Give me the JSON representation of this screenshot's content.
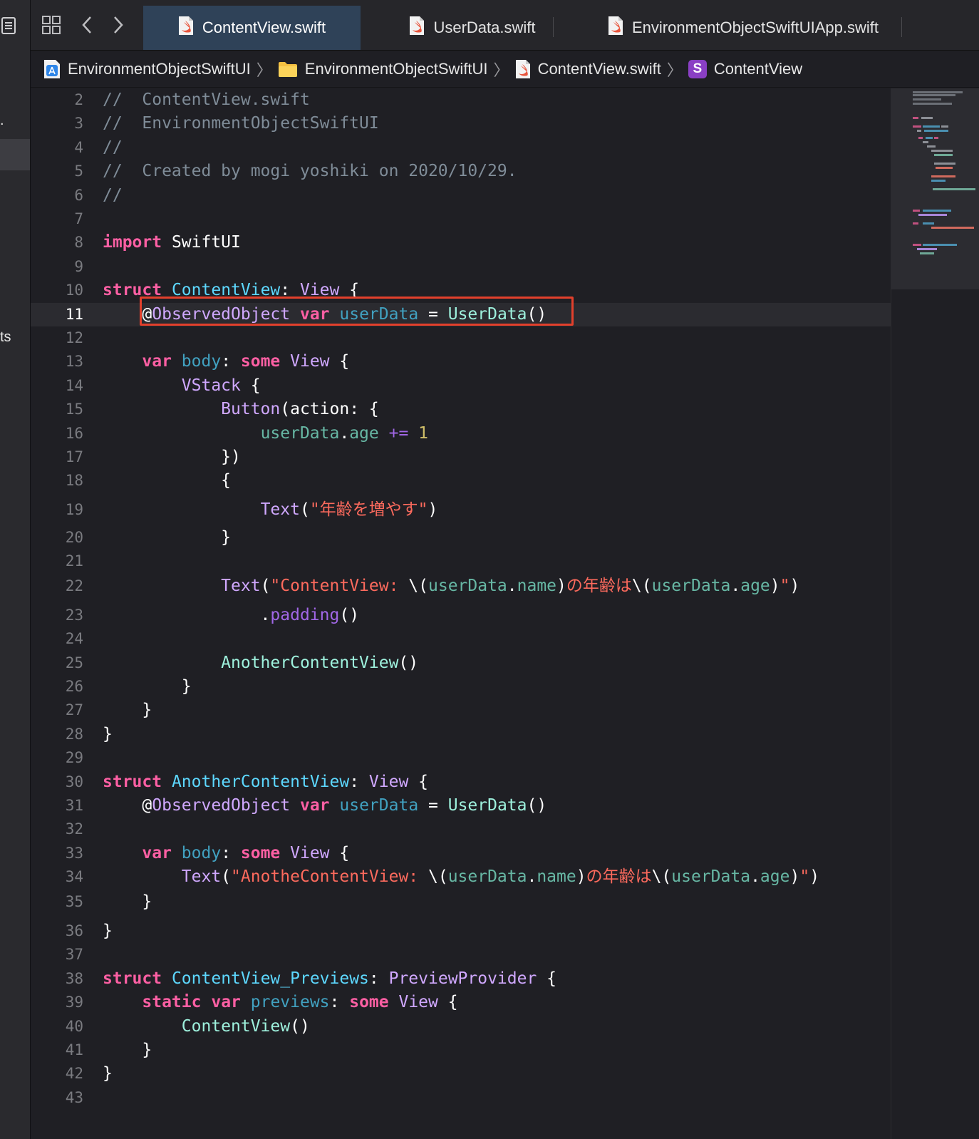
{
  "left_panel": {
    "fragments": [
      ".",
      "ts"
    ]
  },
  "toolbar": {
    "grid_icon": "grid-icon",
    "back_icon": "chevron-left-icon",
    "forward_icon": "chevron-right-icon"
  },
  "tabs": [
    {
      "label": "ContentView.swift",
      "active": true
    },
    {
      "label": "UserData.swift",
      "active": false
    },
    {
      "label": "EnvironmentObjectSwiftUIApp.swift",
      "active": false
    }
  ],
  "breadcrumb": [
    {
      "label": "EnvironmentObjectSwiftUI",
      "icon": "app-project-icon"
    },
    {
      "label": "EnvironmentObjectSwiftUI",
      "icon": "folder-icon"
    },
    {
      "label": "ContentView.swift",
      "icon": "swift-file-icon"
    },
    {
      "label": "ContentView",
      "icon": "struct-icon",
      "badge": "S"
    }
  ],
  "editor": {
    "current_line": 11,
    "highlighted_line": 11,
    "lines": [
      {
        "n": "2",
        "tokens": [
          [
            "cmt",
            "//  ContentView.swift"
          ]
        ]
      },
      {
        "n": "3",
        "tokens": [
          [
            "cmt",
            "//  EnvironmentObjectSwiftUI"
          ]
        ]
      },
      {
        "n": "4",
        "tokens": [
          [
            "cmt",
            "//"
          ]
        ]
      },
      {
        "n": "5",
        "tokens": [
          [
            "cmt",
            "//  Created by mogi yoshiki on 2020/10/29."
          ]
        ]
      },
      {
        "n": "6",
        "tokens": [
          [
            "cmt",
            "//"
          ]
        ]
      },
      {
        "n": "7",
        "tokens": []
      },
      {
        "n": "8",
        "tokens": [
          [
            "kw",
            "import"
          ],
          [
            "pl",
            " SwiftUI"
          ]
        ]
      },
      {
        "n": "9",
        "tokens": []
      },
      {
        "n": "10",
        "tokens": [
          [
            "kw",
            "struct"
          ],
          [
            "pl",
            " "
          ],
          [
            "td",
            "ContentView"
          ],
          [
            "pl",
            ": "
          ],
          [
            "tr",
            "View"
          ],
          [
            "pl",
            " {"
          ]
        ]
      },
      {
        "n": "11",
        "tokens": [
          [
            "pl",
            "    @"
          ],
          [
            "tr",
            "ObservedObject"
          ],
          [
            "pl",
            " "
          ],
          [
            "kw",
            "var"
          ],
          [
            "pl",
            " "
          ],
          [
            "pr",
            "userData"
          ],
          [
            "pl",
            " = "
          ],
          [
            "ot",
            "UserData"
          ],
          [
            "pl",
            "()"
          ]
        ]
      },
      {
        "n": "12",
        "tokens": []
      },
      {
        "n": "13",
        "tokens": [
          [
            "pl",
            "    "
          ],
          [
            "kw",
            "var"
          ],
          [
            "pl",
            " "
          ],
          [
            "pr",
            "body"
          ],
          [
            "pl",
            ": "
          ],
          [
            "kw",
            "some"
          ],
          [
            "pl",
            " "
          ],
          [
            "tr",
            "View"
          ],
          [
            "pl",
            " {"
          ]
        ]
      },
      {
        "n": "14",
        "tokens": [
          [
            "pl",
            "        "
          ],
          [
            "tr",
            "VStack"
          ],
          [
            "pl",
            " {"
          ]
        ]
      },
      {
        "n": "15",
        "tokens": [
          [
            "pl",
            "            "
          ],
          [
            "tr",
            "Button"
          ],
          [
            "pl",
            "(action: {"
          ]
        ]
      },
      {
        "n": "16",
        "tokens": [
          [
            "pl",
            "                "
          ],
          [
            "ov",
            "userData"
          ],
          [
            "pl",
            "."
          ],
          [
            "ov",
            "age"
          ],
          [
            "pl",
            " "
          ],
          [
            "cl",
            "+="
          ],
          [
            "pl",
            " "
          ],
          [
            "num",
            "1"
          ]
        ]
      },
      {
        "n": "17",
        "tokens": [
          [
            "pl",
            "            })"
          ]
        ]
      },
      {
        "n": "18",
        "tokens": [
          [
            "pl",
            "            {"
          ]
        ]
      },
      {
        "n": "19",
        "tokens": [
          [
            "pl",
            "                "
          ],
          [
            "tr",
            "Text"
          ],
          [
            "pl",
            "("
          ],
          [
            "str",
            "\"年齢を増やす\""
          ],
          [
            "pl",
            ")"
          ]
        ]
      },
      {
        "n": "20",
        "tokens": [
          [
            "pl",
            "            }"
          ]
        ]
      },
      {
        "n": "21",
        "tokens": []
      },
      {
        "n": "22",
        "tokens": [
          [
            "pl",
            "            "
          ],
          [
            "tr",
            "Text"
          ],
          [
            "pl",
            "("
          ],
          [
            "str",
            "\"ContentView: "
          ],
          [
            "pl",
            "\\("
          ],
          [
            "ov",
            "userData"
          ],
          [
            "pl",
            "."
          ],
          [
            "ov",
            "name"
          ],
          [
            "pl",
            ")"
          ],
          [
            "str",
            "の年齢は"
          ],
          [
            "pl",
            "\\("
          ],
          [
            "ov",
            "userData"
          ],
          [
            "pl",
            "."
          ],
          [
            "ov",
            "age"
          ],
          [
            "pl",
            ")"
          ],
          [
            "str",
            "\""
          ],
          [
            "pl",
            ")"
          ]
        ]
      },
      {
        "n": "23",
        "tokens": [
          [
            "pl",
            "                ."
          ],
          [
            "cl",
            "padding"
          ],
          [
            "pl",
            "()"
          ]
        ]
      },
      {
        "n": "24",
        "tokens": []
      },
      {
        "n": "25",
        "tokens": [
          [
            "pl",
            "            "
          ],
          [
            "ot",
            "AnotherContentView"
          ],
          [
            "pl",
            "()"
          ]
        ]
      },
      {
        "n": "26",
        "tokens": [
          [
            "pl",
            "        }"
          ]
        ]
      },
      {
        "n": "27",
        "tokens": [
          [
            "pl",
            "    }"
          ]
        ]
      },
      {
        "n": "28",
        "tokens": [
          [
            "pl",
            "}"
          ]
        ]
      },
      {
        "n": "29",
        "tokens": []
      },
      {
        "n": "30",
        "tokens": [
          [
            "kw",
            "struct"
          ],
          [
            "pl",
            " "
          ],
          [
            "td",
            "AnotherContentView"
          ],
          [
            "pl",
            ": "
          ],
          [
            "tr",
            "View"
          ],
          [
            "pl",
            " {"
          ]
        ]
      },
      {
        "n": "31",
        "tokens": [
          [
            "pl",
            "    @"
          ],
          [
            "tr",
            "ObservedObject"
          ],
          [
            "pl",
            " "
          ],
          [
            "kw",
            "var"
          ],
          [
            "pl",
            " "
          ],
          [
            "pr",
            "userData"
          ],
          [
            "pl",
            " = "
          ],
          [
            "ot",
            "UserData"
          ],
          [
            "pl",
            "()"
          ]
        ]
      },
      {
        "n": "32",
        "tokens": []
      },
      {
        "n": "33",
        "tokens": [
          [
            "pl",
            "    "
          ],
          [
            "kw",
            "var"
          ],
          [
            "pl",
            " "
          ],
          [
            "pr",
            "body"
          ],
          [
            "pl",
            ": "
          ],
          [
            "kw",
            "some"
          ],
          [
            "pl",
            " "
          ],
          [
            "tr",
            "View"
          ],
          [
            "pl",
            " {"
          ]
        ]
      },
      {
        "n": "34",
        "tokens": [
          [
            "pl",
            "        "
          ],
          [
            "tr",
            "Text"
          ],
          [
            "pl",
            "("
          ],
          [
            "str",
            "\"AnotheContentView: "
          ],
          [
            "pl",
            "\\("
          ],
          [
            "ov",
            "userData"
          ],
          [
            "pl",
            "."
          ],
          [
            "ov",
            "name"
          ],
          [
            "pl",
            ")"
          ],
          [
            "str",
            "の年齢は"
          ],
          [
            "pl",
            "\\("
          ],
          [
            "ov",
            "userData"
          ],
          [
            "pl",
            "."
          ],
          [
            "ov",
            "age"
          ],
          [
            "pl",
            ")"
          ],
          [
            "str",
            "\""
          ],
          [
            "pl",
            ")"
          ]
        ]
      },
      {
        "n": "35",
        "tokens": [
          [
            "pl",
            "    }"
          ]
        ]
      },
      {
        "n": "36",
        "tokens": [
          [
            "pl",
            "}"
          ]
        ]
      },
      {
        "n": "37",
        "tokens": []
      },
      {
        "n": "38",
        "tokens": [
          [
            "kw",
            "struct"
          ],
          [
            "pl",
            " "
          ],
          [
            "td",
            "ContentView_Previews"
          ],
          [
            "pl",
            ": "
          ],
          [
            "tr",
            "PreviewProvider"
          ],
          [
            "pl",
            " {"
          ]
        ]
      },
      {
        "n": "39",
        "tokens": [
          [
            "pl",
            "    "
          ],
          [
            "kw",
            "static"
          ],
          [
            "pl",
            " "
          ],
          [
            "kw",
            "var"
          ],
          [
            "pl",
            " "
          ],
          [
            "pr",
            "previews"
          ],
          [
            "pl",
            ": "
          ],
          [
            "kw",
            "some"
          ],
          [
            "pl",
            " "
          ],
          [
            "tr",
            "View"
          ],
          [
            "pl",
            " {"
          ]
        ]
      },
      {
        "n": "40",
        "tokens": [
          [
            "pl",
            "        "
          ],
          [
            "ot",
            "ContentView"
          ],
          [
            "pl",
            "()"
          ]
        ]
      },
      {
        "n": "41",
        "tokens": [
          [
            "pl",
            "    }"
          ]
        ]
      },
      {
        "n": "42",
        "tokens": [
          [
            "pl",
            "}"
          ]
        ]
      },
      {
        "n": "43",
        "tokens": []
      }
    ]
  },
  "colors": {
    "comment": "#7f8c98",
    "keyword": "#fc5fa3",
    "type_declaration": "#5dd8ff",
    "type_reference": "#d0a8ff",
    "string": "#fc6a5d",
    "number": "#d0bf69",
    "property": "#41a1c0",
    "highlight_box": "#e2402c",
    "active_tab": "#2f4258"
  }
}
